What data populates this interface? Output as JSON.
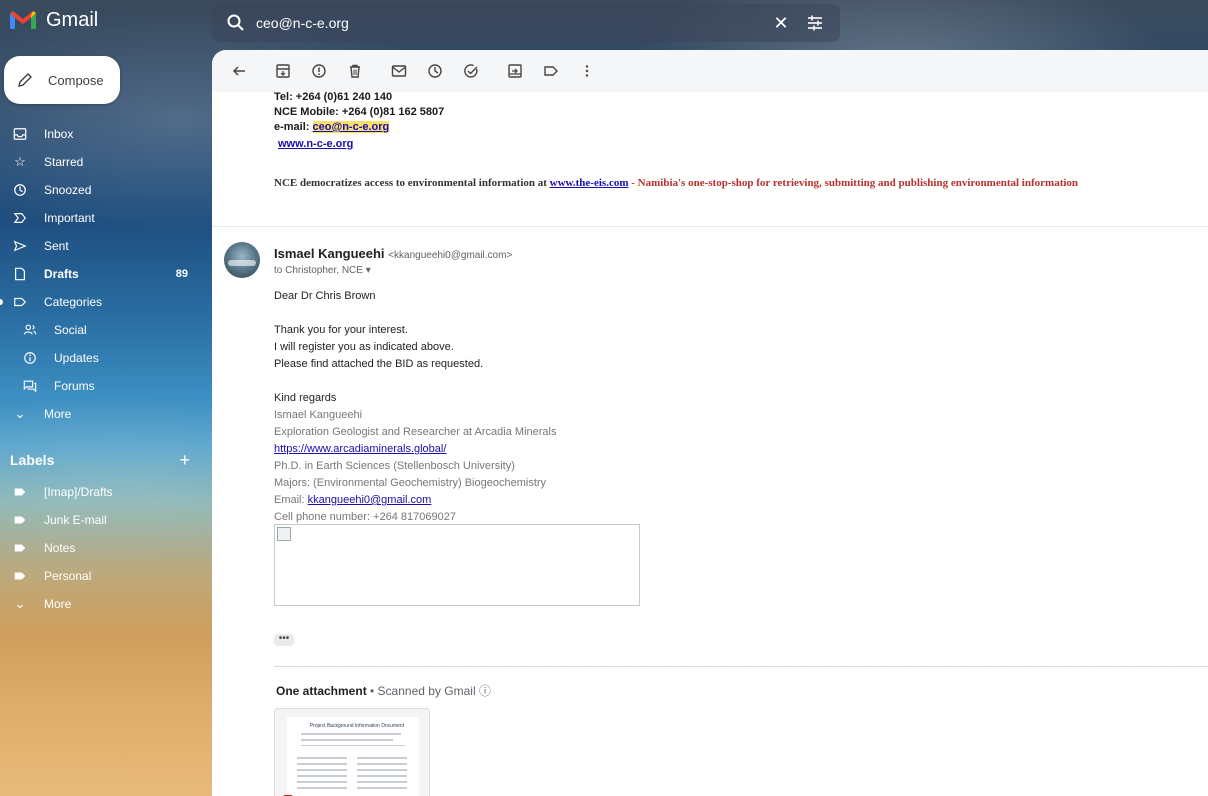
{
  "app": {
    "brand": "Gmail"
  },
  "search": {
    "query": "ceo@n-c-e.org",
    "clear": "✕"
  },
  "compose": {
    "label": "Compose"
  },
  "nav": [
    {
      "label": "Inbox",
      "icon": "inbox-icon",
      "bold": false
    },
    {
      "label": "Starred",
      "icon": "star-icon",
      "bold": false
    },
    {
      "label": "Snoozed",
      "icon": "clock-icon",
      "bold": false
    },
    {
      "label": "Important",
      "icon": "important-icon",
      "bold": false
    },
    {
      "label": "Sent",
      "icon": "send-icon",
      "bold": false
    },
    {
      "label": "Drafts",
      "icon": "draft-icon",
      "bold": true,
      "count": "89"
    },
    {
      "label": "Categories",
      "icon": "label-icon",
      "bold": false
    },
    {
      "label": "Social",
      "icon": "people-icon",
      "bold": false
    },
    {
      "label": "Updates",
      "icon": "info-icon",
      "bold": false
    },
    {
      "label": "Forums",
      "icon": "forum-icon",
      "bold": false
    },
    {
      "label": "More",
      "icon": "chevron-down-icon",
      "bold": false
    }
  ],
  "labels": {
    "header": "Labels",
    "add": "+",
    "items": [
      {
        "label": "[Imap]/Drafts"
      },
      {
        "label": "Junk E-mail"
      },
      {
        "label": "Notes"
      },
      {
        "label": "Personal"
      },
      {
        "label": "More"
      }
    ]
  },
  "prev_message": {
    "tel": "Tel: +264 (0)61 240 140",
    "mobile": "NCE Mobile: +264 (0)81 162 5807",
    "email_prefix": "e-mail: ",
    "email": "ceo@n-c-e.org",
    "website": "www.n-c-e.org",
    "nce_text": "NCE democratizes access to environmental information at ",
    "nce_link": "www.the-eis.com",
    "nce_tail": " - Namibia's one-stop-shop for retrieving, submitting and publishing environmental information"
  },
  "message": {
    "sender_name": "Ismael Kangueehi",
    "sender_email": "<kkangueehi0@gmail.com>",
    "to": "to Christopher, NCE",
    "greeting": "Dear Dr Chris Brown",
    "line1": "Thank you for your interest.",
    "line2": "I will register you as indicated above.",
    "line3": "Please find attached the BID as requested.",
    "closing": "Kind regards",
    "sig_name": "Ismael Kangueehi",
    "sig_title": "Exploration Geologist and Researcher at Arcadia Minerals",
    "sig_link": "https://www.arcadiaminerals.global/",
    "sig_phd": "Ph.D. in Earth Sciences (Stellenbosch University)",
    "sig_majors": "Majors: (Environmental Geochemistry) Biogeochemistry",
    "sig_email_prefix": "Email: ",
    "sig_email": "kkangueehi0@gmail.com",
    "sig_cell": "Cell phone number: +264 817069027",
    "more_dots": "•••"
  },
  "attachments": {
    "header": "One attachment",
    "scanned": " • Scanned by Gmail ⓘ",
    "thumb_title": "Project Background Information Document"
  }
}
